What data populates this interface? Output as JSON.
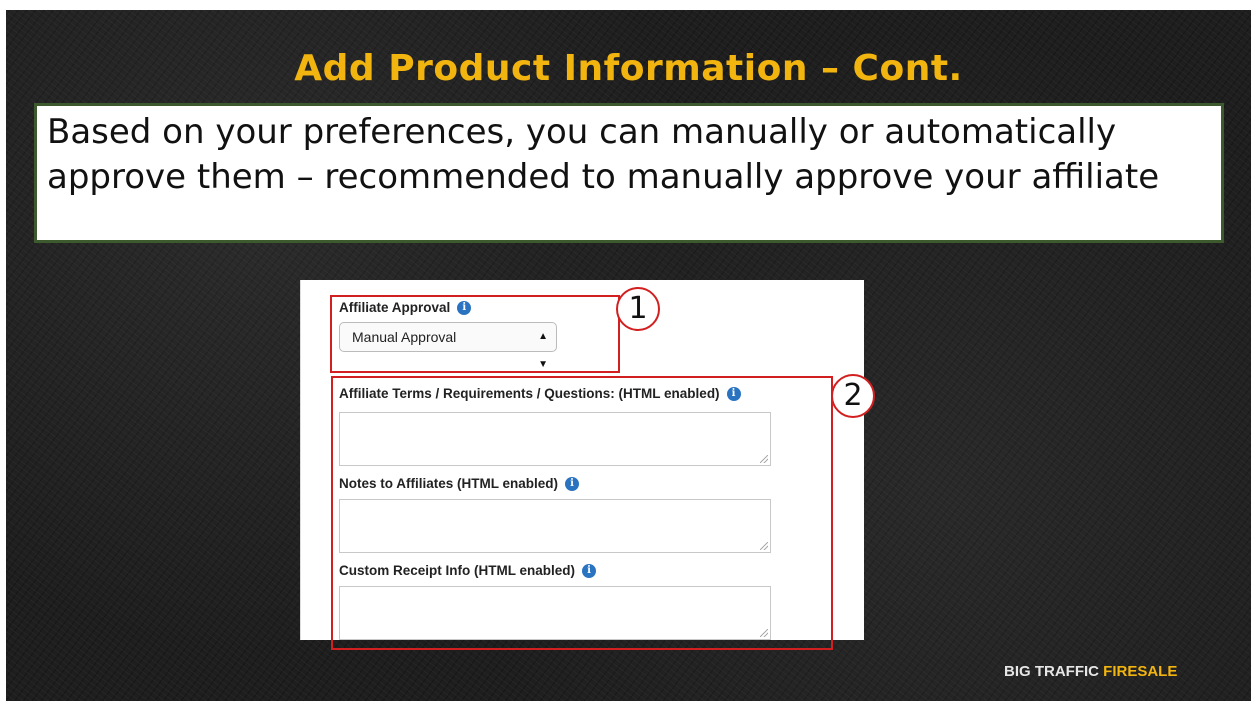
{
  "slide": {
    "title": "Add Product Information – Cont.",
    "callout_text": "Based on your preferences, you can manually or automatically approve them – recommended to manually approve your affiliate"
  },
  "form": {
    "affiliate_approval_label": "Affiliate Approval",
    "affiliate_approval_value": "Manual Approval",
    "terms_label": "Affiliate Terms / Requirements / Questions: (HTML enabled)",
    "terms_value": "",
    "notes_label": "Notes to Affiliates (HTML enabled)",
    "notes_value": "",
    "receipt_label": "Custom Receipt Info (HTML enabled)",
    "receipt_value": "",
    "info_glyph": "i"
  },
  "annotations": {
    "marker_1": "1",
    "marker_2": "2"
  },
  "branding": {
    "part1": "BIG TRAFFIC ",
    "part2": "FIRESALE"
  },
  "colors": {
    "title": "#f2b40f",
    "highlight_box": "#d21f1f",
    "callout_border": "#3c5a2e",
    "info_icon": "#2a73c0"
  },
  "icons": [
    "info-icon",
    "select-arrows-icon",
    "resize-grip-icon"
  ]
}
